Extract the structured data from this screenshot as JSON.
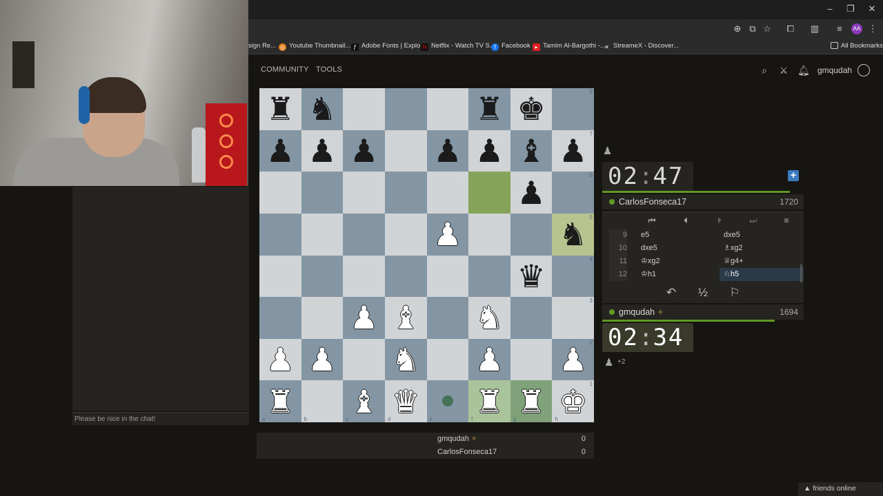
{
  "browser": {
    "bookmarks": [
      {
        "label": "sign Re...",
        "icon": "page-icon"
      },
      {
        "label": "Youtube Thumbnail...",
        "icon": "youtube-thumbnail-icon"
      },
      {
        "label": "Adobe Fonts | Explo...",
        "icon": "adobe-fonts-icon"
      },
      {
        "label": "Netflix - Watch TV S...",
        "icon": "netflix-icon"
      },
      {
        "label": "Facebook",
        "icon": "facebook-icon"
      },
      {
        "label": "Tamim Al-Bargothi -...",
        "icon": "youtube-icon"
      },
      {
        "label": "StreameX - Discover...",
        "icon": "x-icon"
      }
    ],
    "all_bookmarks": "All Bookmarks",
    "profile_initials": "AA"
  },
  "site": {
    "nav": [
      "COMMUNITY",
      "TOOLS"
    ],
    "username": "gmqudah"
  },
  "chat": {
    "placeholder": "Please be nice in the chat!"
  },
  "board": {
    "ranks": [
      "8",
      "7",
      "6",
      "5",
      "4",
      "3",
      "2",
      "1"
    ],
    "files": [
      "a",
      "b",
      "c",
      "d",
      "e",
      "f",
      "g",
      "h"
    ],
    "rows": [
      [
        "br",
        "bn",
        "",
        "",
        "",
        "br",
        "bk",
        ""
      ],
      [
        "bp",
        "bp",
        "bp",
        "",
        "bp",
        "bp",
        "bb",
        "bp"
      ],
      [
        "",
        "",
        "",
        "",
        "",
        "",
        "bp",
        ""
      ],
      [
        "",
        "",
        "",
        "",
        "wp",
        "",
        "",
        "bn"
      ],
      [
        "",
        "",
        "",
        "",
        "",
        "",
        "bq",
        ""
      ],
      [
        "",
        "",
        "wp",
        "wb",
        "",
        "wn",
        "",
        ""
      ],
      [
        "wp",
        "wp",
        "",
        "wn",
        "",
        "wp",
        "",
        "wp"
      ],
      [
        "wr",
        "",
        "wb",
        "wq",
        "",
        "wr",
        "wr",
        "wk"
      ]
    ],
    "last_move": [
      "f6",
      "h5"
    ],
    "selected": [
      "f1",
      "g1"
    ],
    "move_hint": "e1"
  },
  "game": {
    "opponent": {
      "name": "CarlosFonseca17",
      "rating": "1720",
      "clock_min": "02",
      "clock_sec": "47"
    },
    "player": {
      "name": "gmqudah",
      "rating": "1694",
      "clock_min": "02",
      "clock_sec": "34",
      "material": "+2"
    },
    "moves": [
      {
        "n": "9",
        "white": "e5",
        "black": "dxe5"
      },
      {
        "n": "10",
        "white": "dxe5",
        "black": "♗xg2"
      },
      {
        "n": "11",
        "white": "♔xg2",
        "black": "♕g4+"
      },
      {
        "n": "12",
        "white": "♔h1",
        "black": "♘h5"
      }
    ],
    "score": [
      {
        "name": "gmqudah",
        "value": "0"
      },
      {
        "name": "CarlosFonseca17",
        "value": "0"
      }
    ]
  },
  "footer": {
    "friends": "friends online"
  }
}
